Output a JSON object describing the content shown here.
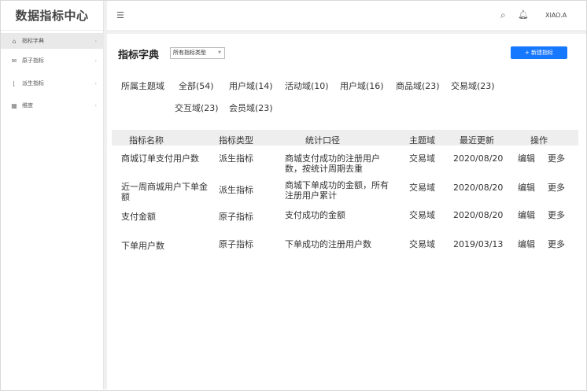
{
  "app": {
    "title": "数据指标中心"
  },
  "sidebar": {
    "items": [
      {
        "label": "指标字典",
        "icon": "home-icon",
        "active": true
      },
      {
        "label": "原子指标",
        "icon": "mail-icon",
        "active": false
      },
      {
        "label": "派生指标",
        "icon": "chart-icon",
        "active": false
      },
      {
        "label": "维度",
        "icon": "grid-icon",
        "active": false
      }
    ]
  },
  "header": {
    "user": "XIAO.A"
  },
  "page": {
    "title": "指标字典",
    "type_select": "所有指标类型",
    "new_button": "+ 新建指标"
  },
  "domains": {
    "label": "所属主题域",
    "items": [
      "全部(54)",
      "用户域(14)",
      "活动域(10)",
      "用户域(16)",
      "商品域(23)",
      "交易域(23)",
      "交互域(23)",
      "会员域(23)"
    ]
  },
  "table": {
    "columns": [
      "指标名称",
      "指标类型",
      "统计口径",
      "主题域",
      "最近更新",
      "操作"
    ],
    "rows": [
      {
        "name": "商城订单支付用户数",
        "type": "派生指标",
        "scope": "商城支付成功的注册用户数，按统计周期去重",
        "domain": "交易域",
        "updated": "2020/08/20",
        "edit": "编辑",
        "more": "更多"
      },
      {
        "name": "近一周商城用户下单金额",
        "type": "派生指标",
        "scope": "商城下单成功的金额，所有注册用户累计",
        "domain": "交易域",
        "updated": "2020/08/20",
        "edit": "编辑",
        "more": "更多"
      },
      {
        "name": "支付金额",
        "type": "原子指标",
        "scope": "支付成功的金额",
        "domain": "交易域",
        "updated": "2020/08/20",
        "edit": "编辑",
        "more": "更多"
      },
      {
        "name": "下单用户数",
        "type": "原子指标",
        "scope": "下单成功的注册用户数",
        "domain": "交易域",
        "updated": "2019/03/13",
        "edit": "编辑",
        "more": "更多"
      }
    ]
  },
  "colors": {
    "primary": "#1677ff",
    "active_bg": "#e9e9e9",
    "header_row_bg": "#eeeeee"
  }
}
